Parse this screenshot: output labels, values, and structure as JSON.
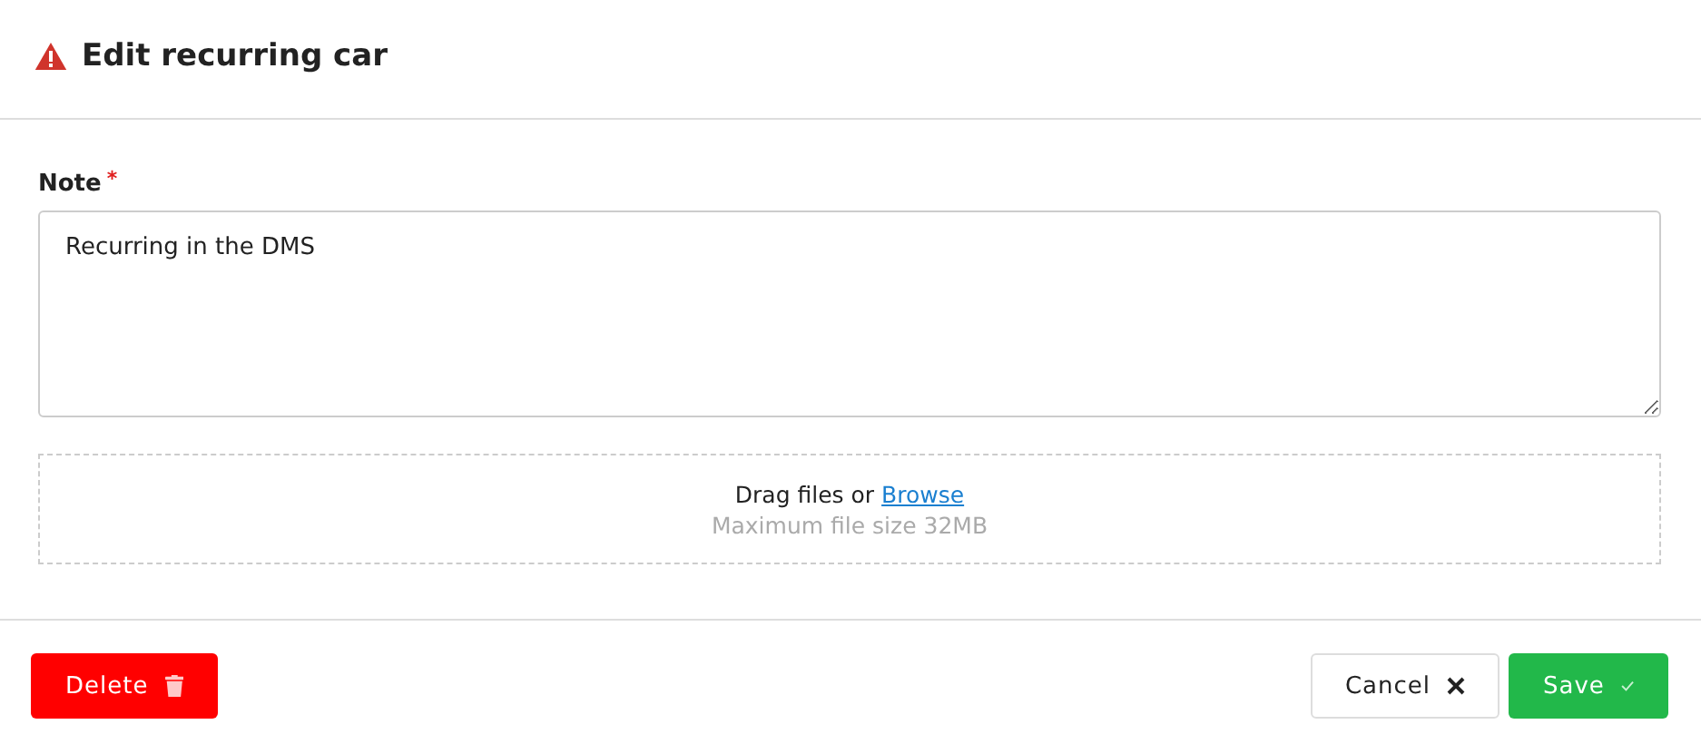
{
  "dialog": {
    "title": "Edit recurring car"
  },
  "note": {
    "label": "Note",
    "required_mark": "*",
    "value": "Recurring in the DMS"
  },
  "dropzone": {
    "text": "Drag files or",
    "link": "Browse",
    "hint": "Maximum file size 32MB"
  },
  "buttons": [
    {
      "kind": "delete",
      "label": "Delete"
    },
    {
      "kind": "cancel",
      "label": "Cancel"
    },
    {
      "kind": "save",
      "label": "Save"
    }
  ]
}
